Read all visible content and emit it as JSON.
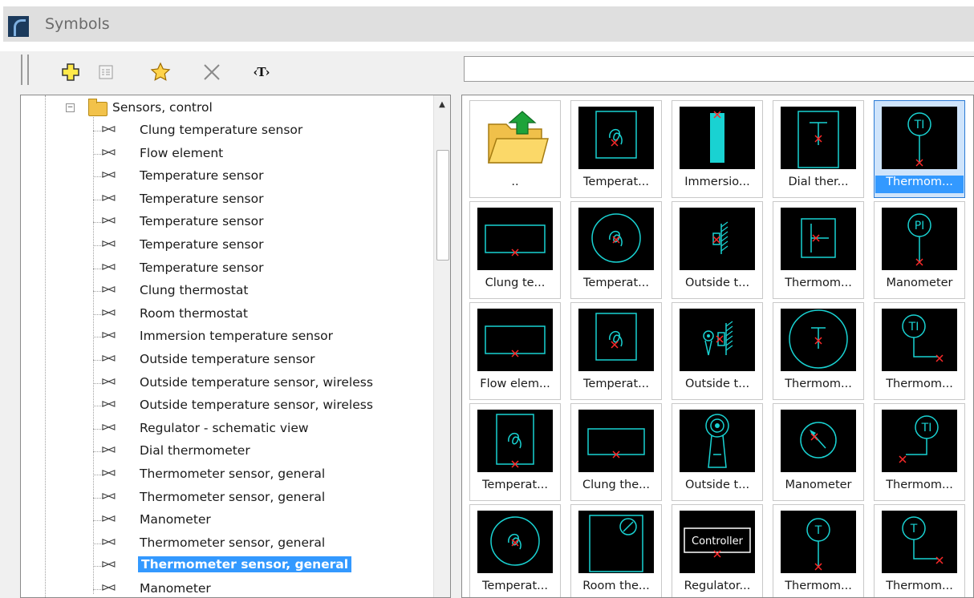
{
  "window": {
    "title": "Symbols"
  },
  "toolbar": {
    "buttons": [
      {
        "name": "add-symbol-button",
        "icon": "plus-icon"
      },
      {
        "name": "properties-button",
        "icon": "properties-icon"
      },
      {
        "name": "favorite-button",
        "icon": "star-icon"
      },
      {
        "name": "delete-button",
        "icon": "delete-icon"
      },
      {
        "name": "text-button",
        "icon": "text-icon",
        "label": "‹T›"
      }
    ]
  },
  "search": {
    "value": ""
  },
  "tree": {
    "root": {
      "label": "Sensors, control",
      "expanded": true
    },
    "items": [
      {
        "label": "Clung temperature sensor"
      },
      {
        "label": "Flow element"
      },
      {
        "label": "Temperature sensor"
      },
      {
        "label": "Temperature sensor"
      },
      {
        "label": "Temperature sensor"
      },
      {
        "label": "Temperature sensor"
      },
      {
        "label": "Temperature sensor"
      },
      {
        "label": "Clung thermostat"
      },
      {
        "label": "Room thermostat"
      },
      {
        "label": "Immersion temperature sensor"
      },
      {
        "label": "Outside temperature sensor"
      },
      {
        "label": "Outside temperature sensor, wireless"
      },
      {
        "label": "Outside temperature sensor, wireless"
      },
      {
        "label": "Regulator - schematic view"
      },
      {
        "label": "Dial thermometer"
      },
      {
        "label": "Thermometer sensor, general"
      },
      {
        "label": "Thermometer sensor, general"
      },
      {
        "label": "Manometer"
      },
      {
        "label": "Thermometer sensor, general"
      },
      {
        "label": "Thermometer sensor, general",
        "selected": true
      },
      {
        "label": "Manometer"
      }
    ]
  },
  "grid": {
    "items": [
      {
        "caption": "..",
        "symbol": "folder-up"
      },
      {
        "caption": "Temperat...",
        "symbol": "temp-square"
      },
      {
        "caption": "Immersio...",
        "symbol": "immersion"
      },
      {
        "caption": "Dial ther...",
        "symbol": "dial-thermo"
      },
      {
        "caption": "Thermom...",
        "symbol": "ti-stem",
        "selected": true
      },
      {
        "caption": "Clung te...",
        "symbol": "rect"
      },
      {
        "caption": "Temperat...",
        "symbol": "temp-circle"
      },
      {
        "caption": "Outside t...",
        "symbol": "outside-small"
      },
      {
        "caption": "Thermom...",
        "symbol": "thermo-cross"
      },
      {
        "caption": "Manometer",
        "symbol": "pi-stem"
      },
      {
        "caption": "Flow elem...",
        "symbol": "rect"
      },
      {
        "caption": "Temperat...",
        "symbol": "temp-square"
      },
      {
        "caption": "Outside t...",
        "symbol": "outside-wireless"
      },
      {
        "caption": "Thermom...",
        "symbol": "thermo-circle-big"
      },
      {
        "caption": "Thermom...",
        "symbol": "ti-angle"
      },
      {
        "caption": "Temperat...",
        "symbol": "temp-square-tall"
      },
      {
        "caption": "Clung the...",
        "symbol": "rect-small"
      },
      {
        "caption": "Outside t...",
        "symbol": "antenna"
      },
      {
        "caption": "Manometer",
        "symbol": "manometer-dial"
      },
      {
        "caption": "Thermom...",
        "symbol": "ti-angle-left"
      },
      {
        "caption": "Temperat...",
        "symbol": "temp-circle"
      },
      {
        "caption": "Room the...",
        "symbol": "room-thermo"
      },
      {
        "caption": "Regulator...",
        "symbol": "controller",
        "text": "Controller"
      },
      {
        "caption": "Thermom...",
        "symbol": "t-stem"
      },
      {
        "caption": "Thermom...",
        "symbol": "t-angle"
      }
    ]
  },
  "colors": {
    "symbol": "#19d2d2",
    "marker": "#ff2a2a",
    "selection": "#3399ff"
  }
}
